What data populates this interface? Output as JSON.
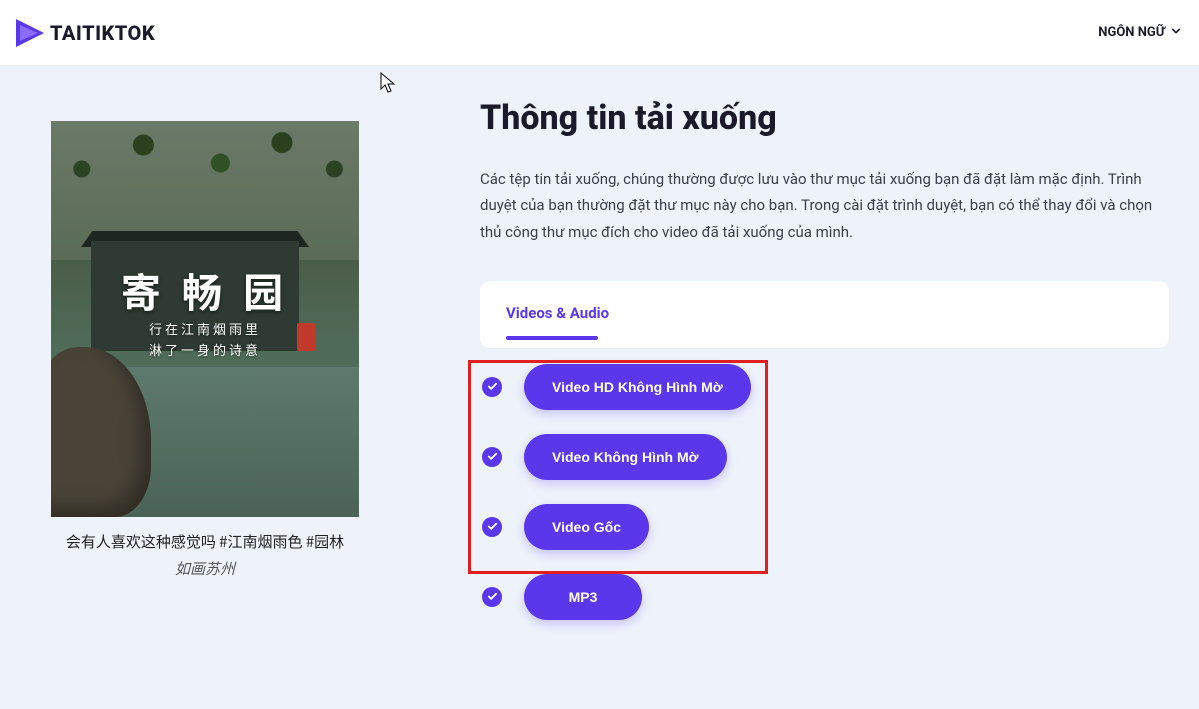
{
  "header": {
    "brand": "TAITIKTOK",
    "language_label": "NGÔN NGỮ"
  },
  "left": {
    "thumb_title": "寄 畅 园",
    "thumb_sub_line1": "行在江南烟雨里",
    "thumb_sub_line2": "淋了一身的诗意",
    "caption_line1": "会有人喜欢这种感觉吗 #江南烟雨色 #园林",
    "caption_line2": "如画苏州"
  },
  "right": {
    "title": "Thông tin tải xuống",
    "description": "Các tệp tin tải xuống, chúng thường được lưu vào thư mục tải xuống bạn đã đặt làm mặc định. Trình duyệt của bạn thường đặt thư mục này cho bạn. Trong cài đặt trình duyệt, bạn có thể thay đổi và chọn thủ công thư mục đích cho video đã tải xuống của mình.",
    "tab_label": "Videos & Audio",
    "options": {
      "hd_no_watermark": "Video HD Không Hình Mờ",
      "no_watermark": "Video Không Hình Mờ",
      "original": "Video Gốc",
      "mp3": "MP3"
    }
  },
  "colors": {
    "accent": "#5a37eb",
    "highlight": "#e02020"
  }
}
